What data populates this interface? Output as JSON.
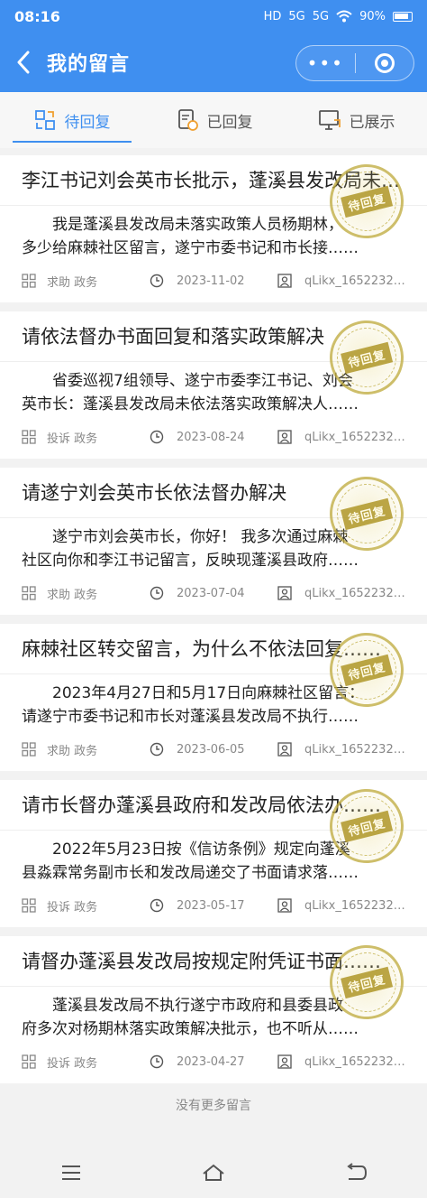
{
  "status": {
    "time": "08:16",
    "hd": "HD",
    "net1": "5G",
    "net2": "5G",
    "battery": "90%"
  },
  "header": {
    "title": "我的留言",
    "more_label": "•••"
  },
  "tabs": [
    {
      "label": "待回复",
      "icon": "pending-reply-icon",
      "active": true
    },
    {
      "label": "已回复",
      "icon": "replied-icon",
      "active": false
    },
    {
      "label": "已展示",
      "icon": "displayed-icon",
      "active": false
    }
  ],
  "messages": [
    {
      "title": "李江书记刘会英市长批示，蓬溪县发改局未落实政策人员杨期林……",
      "body1": "我是蓬溪县发改局未落实政策人员杨期林，",
      "body2": "多少给麻棘社区留言，遂宁市委书记和市长接……",
      "tag": "求助 政务",
      "date": "2023-11-02",
      "user": "qLikx_1652232…",
      "stamp": "待回复"
    },
    {
      "title": "请依法督办书面回复和落实政策解决",
      "body1": "省委巡视7组领导、遂宁市委李江书记、刘会",
      "body2": "英市长：蓬溪县发改局未依法落实政策解决人……",
      "tag": "投诉 政务",
      "date": "2023-08-24",
      "user": "qLikx_1652232…",
      "stamp": "待回复"
    },
    {
      "title": "请遂宁刘会英市长依法督办解决",
      "body1": "遂宁市刘会英市长，你好！ 我多次通过麻棘",
      "body2": "社区向你和李江书记留言，反映现蓬溪县政府……",
      "tag": "求助 政务",
      "date": "2023-07-04",
      "user": "qLikx_1652232…",
      "stamp": "待回复"
    },
    {
      "title": "麻棘社区转交留言，为什么不依法回复……",
      "body1": "2023年4月27日和5月17日向麻棘社区留言：",
      "body2": "请遂宁市委书记和市长对蓬溪县发改局不执行……",
      "tag": "求助 政务",
      "date": "2023-06-05",
      "user": "qLikx_1652232…",
      "stamp": "待回复"
    },
    {
      "title": "请市长督办蓬溪县政府和发改局依法办……",
      "body1": "2022年5月23日按《信访条例》规定向蓬溪",
      "body2": "县淼霖常务副市长和发改局递交了书面请求落……",
      "tag": "投诉 政务",
      "date": "2023-05-17",
      "user": "qLikx_1652232…",
      "stamp": "待回复"
    },
    {
      "title": "请督办蓬溪县发改局按规定附凭证书面……",
      "body1": "蓬溪县发改局不执行遂宁市政府和县委县政",
      "body2": "府多次对杨期林落实政策解决批示，也不听从……",
      "tag": "投诉 政务",
      "date": "2023-04-27",
      "user": "qLikx_1652232…",
      "stamp": "待回复"
    }
  ],
  "footer": {
    "no_more": "没有更多留言"
  },
  "colors": {
    "primary": "#3f8ff0",
    "stamp": "#af9628"
  }
}
